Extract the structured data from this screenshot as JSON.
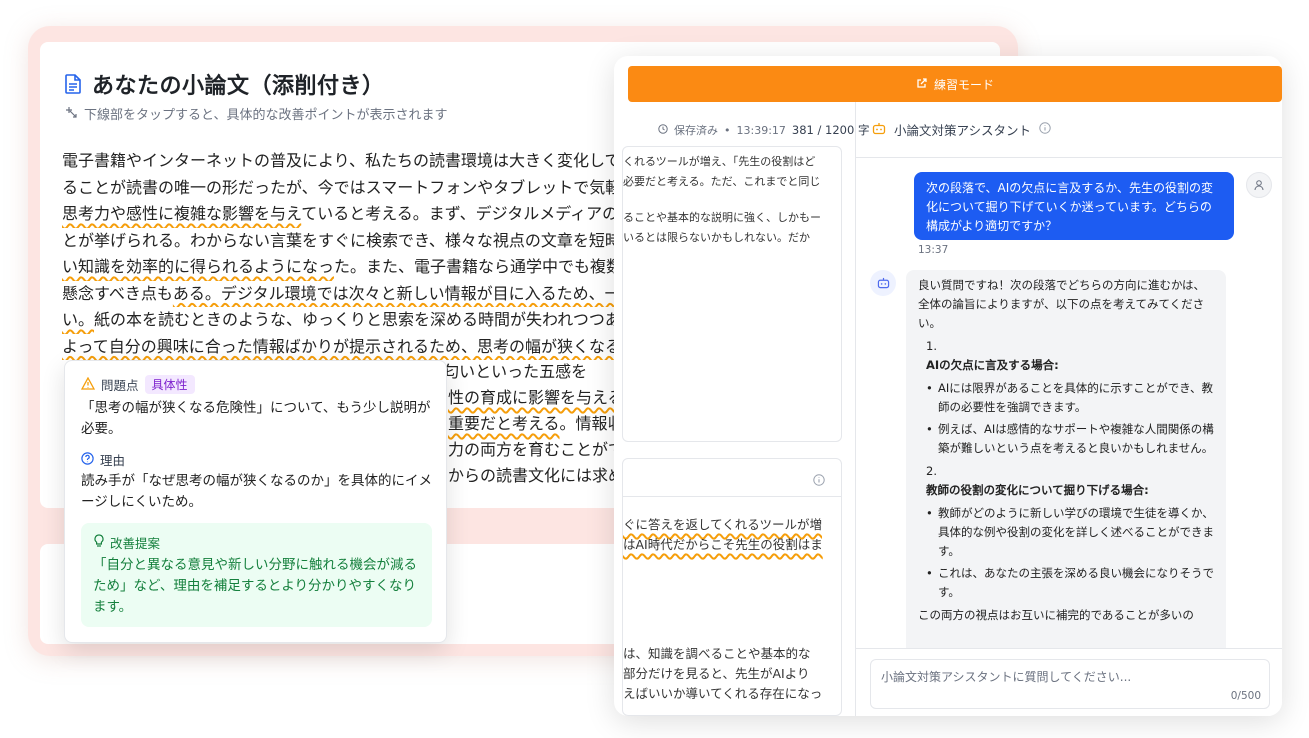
{
  "essay": {
    "title": "あなたの小論文（添削付き）",
    "hint": "下線部をタップすると、具体的な改善ポイントが表示されます",
    "lines": [
      "電子書籍やインターネットの普及により、私たちの読書環境は大きく変化して",
      "ることが読書の唯一の形だったが、今ではスマートフォンやタブレットで気軽",
      "思考力や感性に複雑な影響を与えていると考える。まず、デジタルメディアの利",
      "とが挙げられる。わからない言葉をすぐに検索でき、様々な視点の文章を短時",
      "い知識を効率的に得られるようになった。また、電子書籍なら通学中でも複数",
      "懸念すべき点もある。デジタル環境では次々と新しい情報が目に入るため、一つ",
      "い。紙の本を読むときのような、ゆっくりと思索を深める時間が失われつつあ",
      "よって自分の興味に合った情報ばかりが提示されるため、思考の幅が狭くなる"
    ],
    "fragments": [
      "ク の匂いといった五感を",
      "性の育成に影響を与える",
      "重要だと考える。情報収",
      "力の両方を育むことがで",
      "からの読書文化には求め"
    ]
  },
  "popover": {
    "problem_label": "問題点",
    "badge": "具体性",
    "problem_text": "「思考の幅が狭くなる危険性」について、もう少し説明が必要。",
    "reason_label": "理由",
    "reason_text": "読み手が「なぜ思考の幅が狭くなるのか」を具体的にイメージしにくいため。",
    "suggest_label": "改善提案",
    "suggest_text": "「自分と異なる意見や新しい分野に触れる機会が減るため」など、理由を補足するとより分かりやすくなります。"
  },
  "front": {
    "mode_label": "練習モード",
    "saved": "保存済み",
    "time": "13:39:17",
    "count": "381 / 1200 字",
    "mini1_lines": [
      "くれるツールが増え、「先生の役割はど",
      "必要だと考える。ただ、これまでと同じ",
      "",
      "ることや基本的な説明に強く、しかもー",
      "いるとは限らないかもしれない。だか"
    ],
    "mini2_lines": [
      "ぐに答えを返してくれるツールが増",
      "はAI時代だからこそ先生の役割はま",
      "",
      "",
      "",
      "は、知識を調べることや基本的な",
      "部分だけを見ると、先生がAIより",
      "えばいいか導いてくれる存在になっ"
    ]
  },
  "chat": {
    "title": "小論文対策アシスタント",
    "user_msg": "次の段落で、AIの欠点に言及するか、先生の役割の変化について掘り下げていくか迷っています。どちらの構成がより適切ですか？",
    "user_time": "13:37",
    "ai_intro": "良い質問ですね！次の段落でどちらの方向に進むかは、全体の論旨によりますが、以下の点を考えてみてください。",
    "n1": "1.",
    "h1": "AIの欠点に言及する場合:",
    "b1": [
      "AIには限界があることを具体的に示すことができ、教師の必要性を強調できます。",
      "例えば、AIは感情的なサポートや複雑な人間関係の構築が難しいという点を考えると良いかもしれません。"
    ],
    "n2": "2.",
    "h2": "教師の役割の変化について掘り下げる場合:",
    "b2": [
      "教師がどのように新しい学びの環境で生徒を導くか、具体的な例や役割の変化を詳しく述べることができます。",
      "これは、あなたの主張を深める良い機会になりそうです。"
    ],
    "ai_tail": "この両方の視点はお互いに補完的であることが多いの",
    "placeholder": "小論文対策アシスタントに質問してください...",
    "counter": "0/500"
  },
  "colors": {
    "accent": "#fb8a13",
    "user_bubble": "#1d5cf2",
    "underline": "#f59e0b",
    "suggest_bg": "#ecfdf3",
    "back_bg": "#fde5e2"
  }
}
